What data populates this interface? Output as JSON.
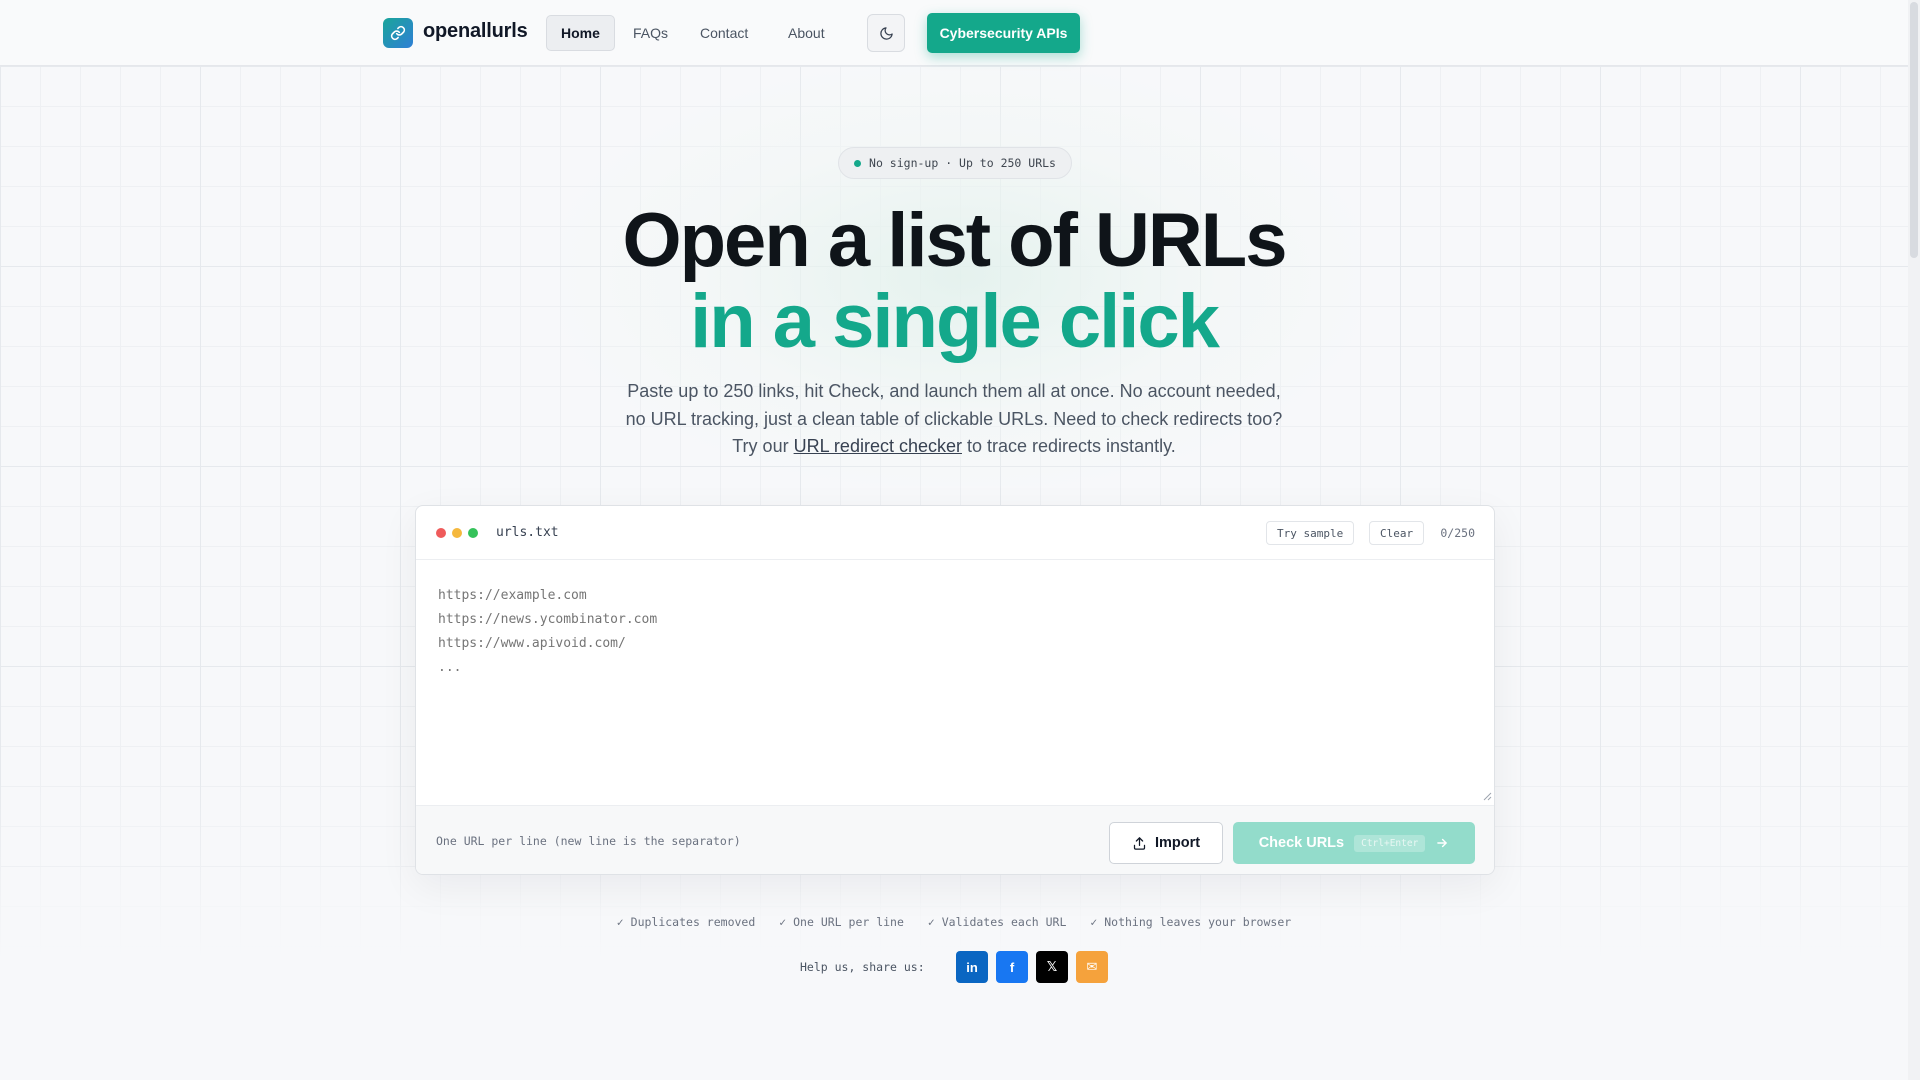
{
  "header": {
    "brand": "openallurls",
    "nav": [
      "Home",
      "FAQs",
      "Contact",
      "About"
    ],
    "active_nav": "Home",
    "cta": "Cybersecurity APIs"
  },
  "hero": {
    "badge": "No sign-up · Up to 250 URLs",
    "title_line1": "Open a list of URLs",
    "title_line2": "in a single click",
    "sub_line1": "Paste up to 250 links, hit Check, and launch them all at once. No account needed,",
    "sub_line2": "no URL tracking, just a clean table of clickable URLs. Need to check redirects too?",
    "sub_line3_pre": "Try our",
    "sub_link": "URL redirect checker",
    "sub_line3_post": "to trace redirects instantly."
  },
  "editor": {
    "filename": "urls.txt",
    "try_sample": "Try sample",
    "clear": "Clear",
    "counter": "0/250",
    "placeholder": "https://example.com\nhttps://news.ycombinator.com\nhttps://www.apivoid.com/\n...",
    "hint": "One URL per line (new line is the separator)",
    "import": "Import",
    "check": "Check URLs",
    "shortcut": "Ctrl+Enter"
  },
  "features": [
    "✓ Duplicates removed",
    "✓ One URL per line",
    "✓ Validates each URL",
    "✓ Nothing leaves your browser"
  ],
  "share": {
    "label": "Help us, share us:",
    "buttons": [
      {
        "name": "linkedin",
        "glyph": "in",
        "color": "#0a66c2"
      },
      {
        "name": "facebook",
        "glyph": "f",
        "color": "#1877f2"
      },
      {
        "name": "x",
        "glyph": "𝕏",
        "color": "#000000"
      },
      {
        "name": "email",
        "glyph": "✉",
        "color": "#f5a23c"
      }
    ]
  },
  "colors": {
    "accent": "#14a88b",
    "accent_disabled": "#93dccb"
  }
}
